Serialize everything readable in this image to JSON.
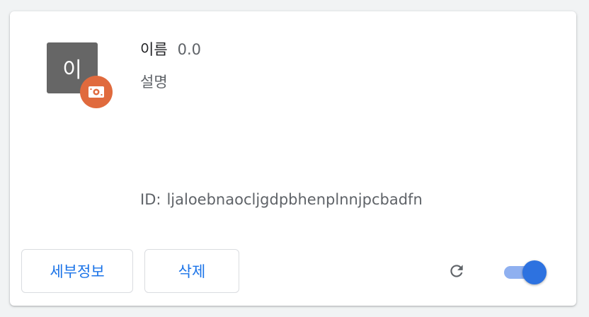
{
  "extension": {
    "icon_letter": "이",
    "name": "이름",
    "version": "0.0",
    "description": "설명",
    "id_label": "ID:",
    "id_value": "ljaloebnaocljgdpbhenplnnjpcbadfn"
  },
  "actions": {
    "details_label": "세부정보",
    "remove_label": "삭제"
  },
  "toggle": {
    "enabled": true
  },
  "colors": {
    "accent": "#1a73e8",
    "badge": "#e06a3d",
    "icon_bg": "#666666",
    "toggle_track": "#8fb0f0",
    "toggle_knob": "#2d72e0"
  },
  "icons": {
    "badge": "unpacked-extension-icon",
    "reload": "reload-icon"
  }
}
